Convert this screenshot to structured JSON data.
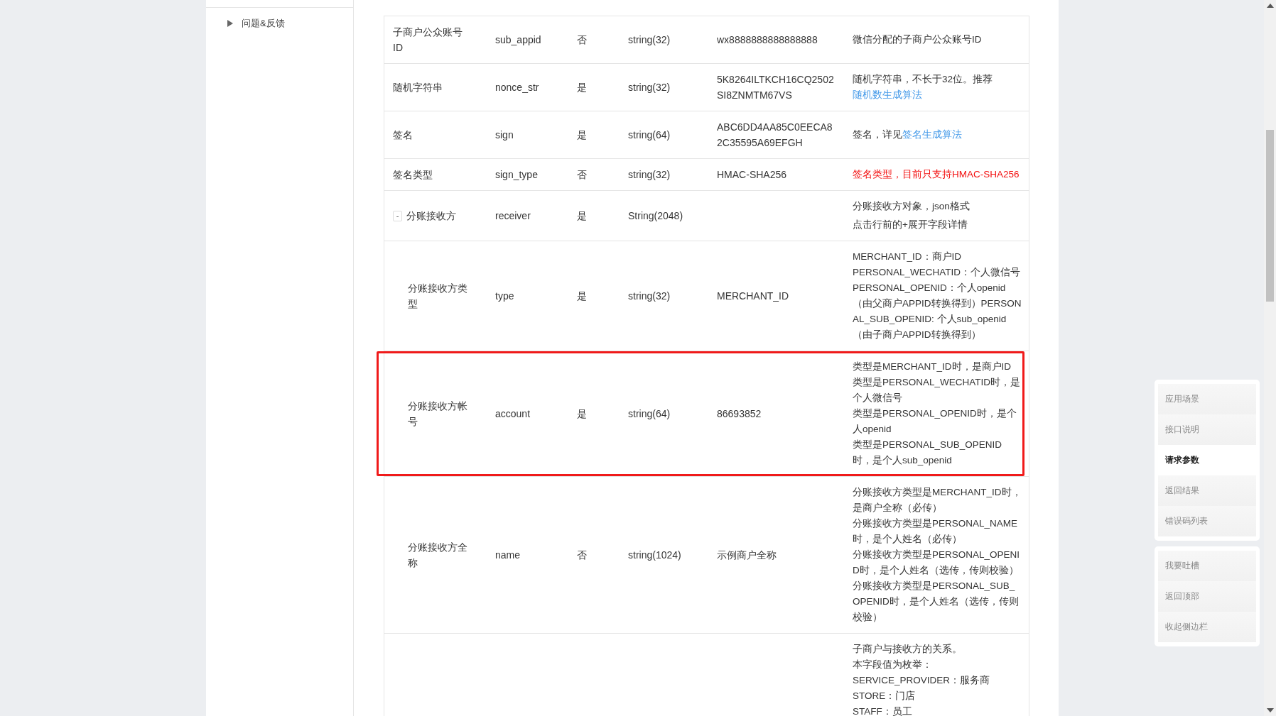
{
  "sidebar": {
    "items": [
      {
        "label": "问题&反馈",
        "expanded": false
      }
    ]
  },
  "table": {
    "rows": [
      {
        "name": "子商户公众账号ID",
        "field": "sub_appid",
        "required": "否",
        "type": "string(32)",
        "example": "wx8888888888888888",
        "highlighted": false,
        "description": [
          [
            {
              "kind": "text",
              "text": "微信分配的子商户公众账号ID"
            }
          ]
        ]
      },
      {
        "name": "随机字符串",
        "field": "nonce_str",
        "required": "是",
        "type": "string(32)",
        "example": "5K8264ILTKCH16CQ2502SI8ZNMTM67VS",
        "highlighted": false,
        "description": [
          [
            {
              "kind": "text",
              "text": "随机字符串，不长于32位。推荐"
            },
            {
              "kind": "link",
              "text": "随机数生成算法"
            }
          ]
        ]
      },
      {
        "name": "签名",
        "field": "sign",
        "required": "是",
        "type": "string(64)",
        "example": "ABC6DD4AA85C0EECA82C35595A69EFGH",
        "highlighted": false,
        "description": [
          [
            {
              "kind": "text",
              "text": "签名，详见"
            },
            {
              "kind": "link",
              "text": "签名生成算法"
            }
          ]
        ]
      },
      {
        "name": "签名类型",
        "field": "sign_type",
        "required": "否",
        "type": "string(32)",
        "example": "HMAC-SHA256",
        "highlighted": false,
        "description": [
          [
            {
              "kind": "warning",
              "text": "签名类型，目前只支持HMAC-SHA256"
            }
          ]
        ]
      },
      {
        "name": "分账接收方",
        "field": "receiver",
        "required": "是",
        "type": "String(2048)",
        "highlighted": false,
        "expanded": true,
        "toggle": "-",
        "description": [
          [
            {
              "kind": "text",
              "text": "分账接收方对象，json格式"
            }
          ],
          [
            {
              "kind": "text",
              "text": "点击行前的+展开字段详情"
            }
          ]
        ],
        "children": [
          {
            "name": "分账接收方类型",
            "field": "type",
            "required": "是",
            "type": "string(32)",
            "example": "MERCHANT_ID",
            "highlighted": false,
            "description": [
              [
                {
                  "kind": "text",
                  "text": "MERCHANT_ID：商户ID"
                }
              ],
              [
                {
                  "kind": "text",
                  "text": "PERSONAL_WECHATID：个人微信号"
                }
              ],
              [
                {
                  "kind": "text",
                  "text": "PERSONAL_OPENID：个人openid（由父商户APPID转换得到）PERSONAL_SUB_OPENID: 个人sub_openid（由子商户APPID转换得到）"
                }
              ]
            ]
          },
          {
            "name": "分账接收方帐号",
            "field": "account",
            "required": "是",
            "type": "string(64)",
            "example": "86693852",
            "highlighted": true,
            "description": [
              [
                {
                  "kind": "text",
                  "text": "类型是MERCHANT_ID时，是商户ID"
                }
              ],
              [
                {
                  "kind": "text",
                  "text": "类型是PERSONAL_WECHATID时，是个人微信号"
                }
              ],
              [
                {
                  "kind": "text",
                  "text": "类型是PERSONAL_OPENID时，是个人openid"
                }
              ],
              [
                {
                  "kind": "text",
                  "text": "类型是PERSONAL_SUB_OPENID时，是个人sub_openid"
                }
              ]
            ]
          },
          {
            "name": "分账接收方全称",
            "field": "name",
            "required": "否",
            "type": "string(1024)",
            "example": "示例商户全称",
            "highlighted": false,
            "description": [
              [
                {
                  "kind": "text",
                  "text": "分账接收方类型是MERCHANT_ID时，是商户全称（必传）"
                }
              ],
              [
                {
                  "kind": "text",
                  "text": "分账接收方类型是PERSONAL_NAME 时，是个人姓名（必传）"
                }
              ],
              [
                {
                  "kind": "text",
                  "text": "分账接收方类型是PERSONAL_OPENID时，是个人姓名（选传，传则校验）"
                }
              ],
              [
                {
                  "kind": "text",
                  "text": "分账接收方类型是PERSONAL_SUB_OPENID时，是个人姓名（选传，传则校验）"
                }
              ]
            ]
          },
          {
            "highlighted": false,
            "description": [
              [
                {
                  "kind": "text",
                  "text": "子商户与接收方的关系。"
                }
              ],
              [
                {
                  "kind": "text",
                  "text": "本字段值为枚举："
                }
              ],
              [
                {
                  "kind": "text",
                  "text": "SERVICE_PROVIDER：服务商"
                }
              ],
              [
                {
                  "kind": "text",
                  "text": "STORE：门店"
                }
              ],
              [
                {
                  "kind": "text",
                  "text": "STAFF：员工"
                }
              ]
            ]
          }
        ]
      }
    ]
  },
  "float_nav": {
    "groups": [
      {
        "items": [
          {
            "label": "应用场景",
            "selected": false
          },
          {
            "label": "接口说明",
            "selected": false
          },
          {
            "label": "请求参数",
            "selected": true
          },
          {
            "label": "返回结果",
            "selected": false
          },
          {
            "label": "错误码列表",
            "selected": false
          }
        ]
      },
      {
        "items": [
          {
            "label": "我要吐槽",
            "selected": false
          },
          {
            "label": "返回顶部",
            "selected": false
          },
          {
            "label": "收起侧边栏",
            "selected": false
          }
        ]
      }
    ]
  }
}
